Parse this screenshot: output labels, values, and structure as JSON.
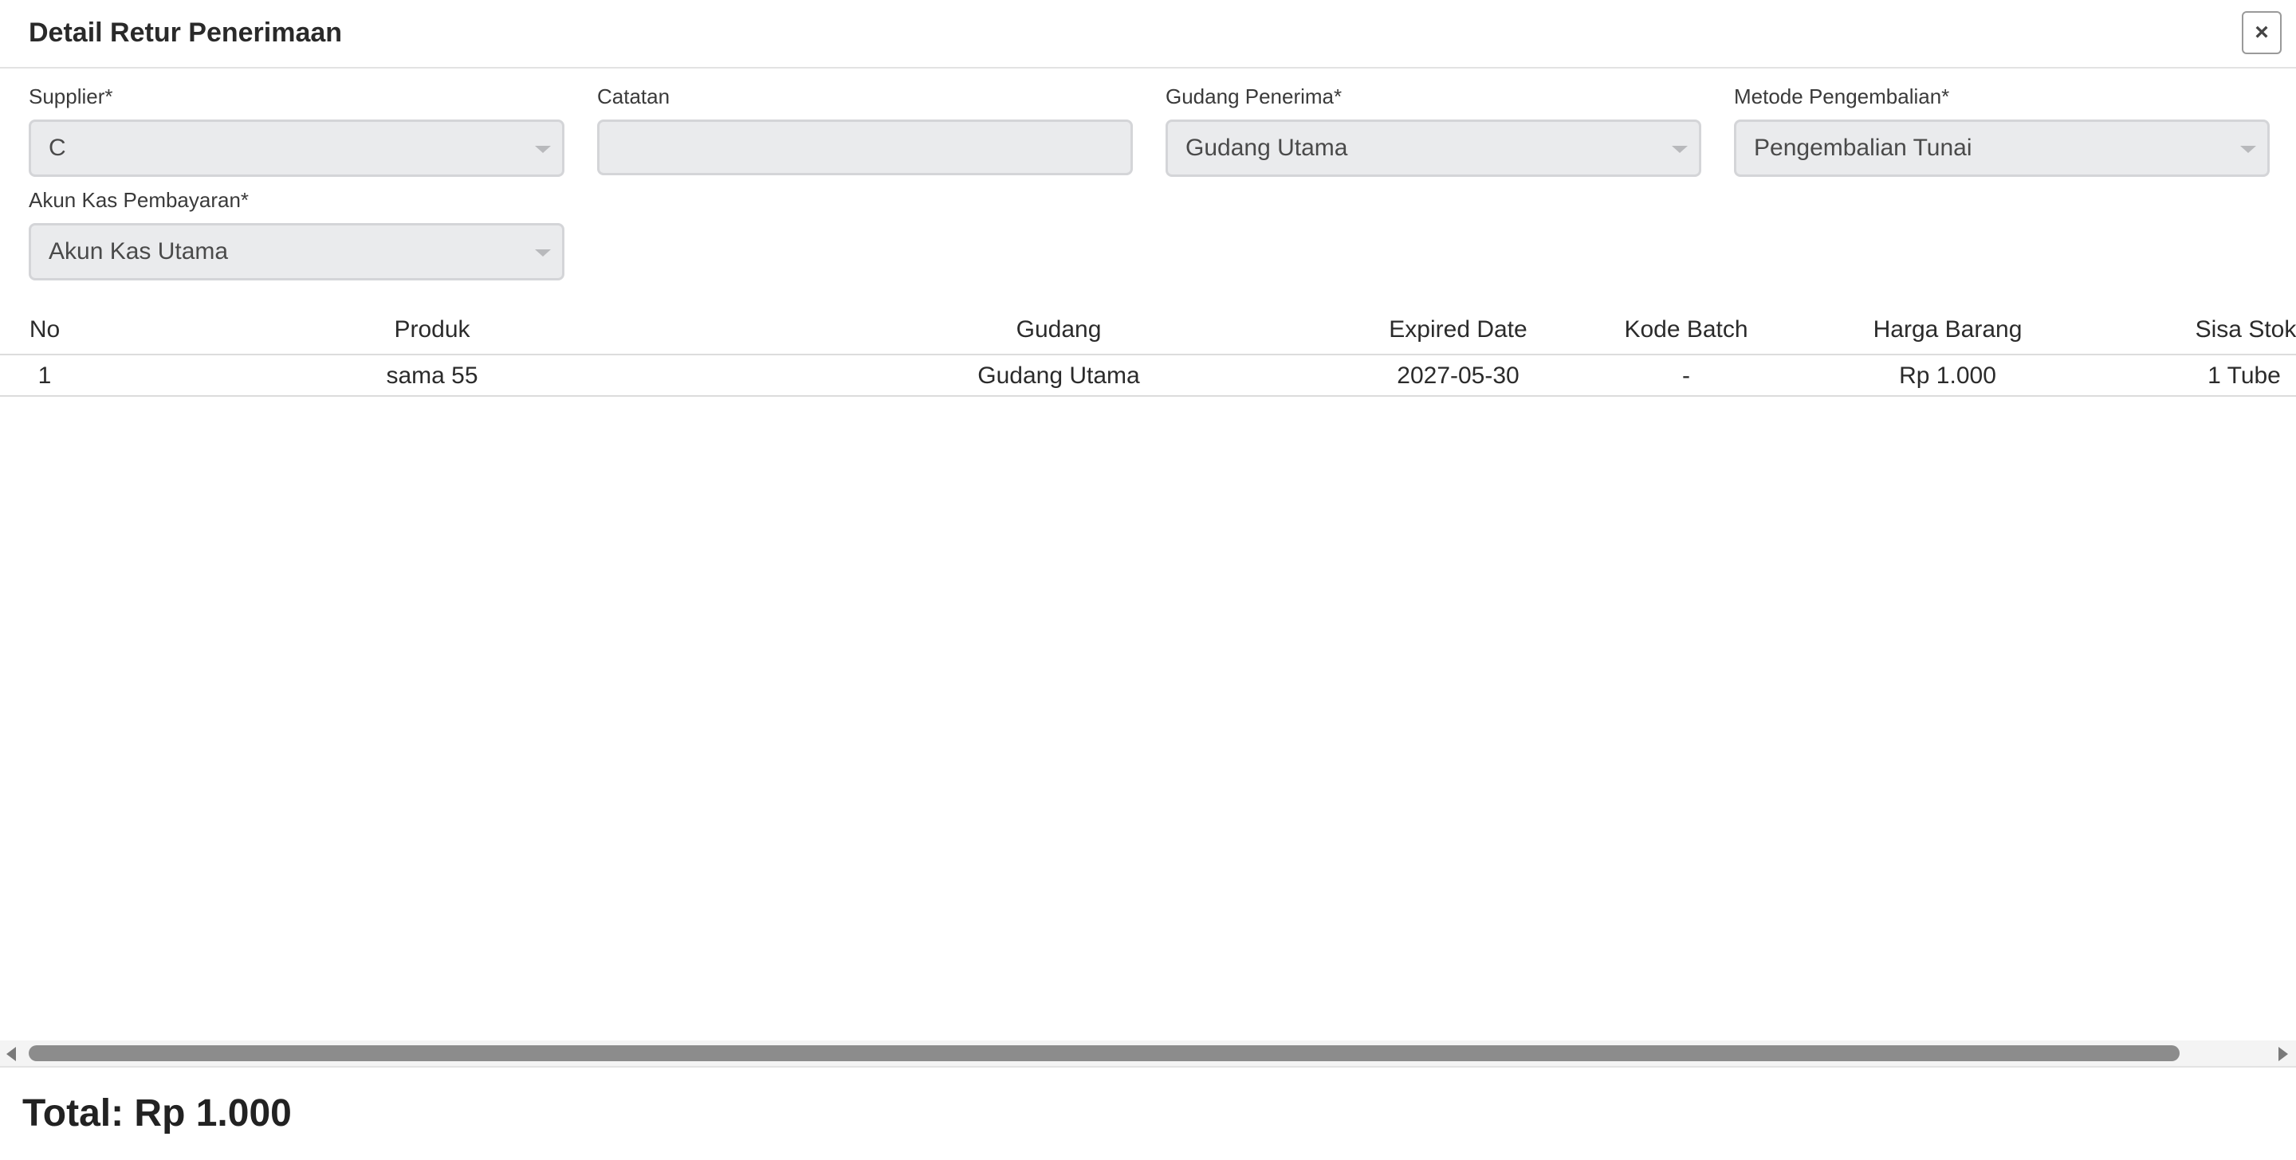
{
  "modal": {
    "title": "Detail Retur Penerimaan",
    "close_label": "×"
  },
  "form": {
    "supplier": {
      "label": "Supplier*",
      "value": "C"
    },
    "catatan": {
      "label": "Catatan",
      "value": ""
    },
    "gudang_penerima": {
      "label": "Gudang Penerima*",
      "value": "Gudang Utama"
    },
    "metode_pengembalian": {
      "label": "Metode Pengembalian*",
      "value": "Pengembalian Tunai"
    },
    "akun_kas": {
      "label": "Akun Kas Pembayaran*",
      "value": "Akun Kas Utama"
    }
  },
  "table": {
    "headers": [
      "No",
      "Produk",
      "Gudang",
      "Expired Date",
      "Kode Batch",
      "Harga Barang",
      "Sisa Stok"
    ],
    "rows": [
      [
        "1",
        "sama 55",
        "Gudang Utama",
        "2027-05-30",
        "-",
        "Rp 1.000",
        "1 Tube"
      ]
    ]
  },
  "footer": {
    "total": "Total: Rp 1.000"
  },
  "colors": {
    "field_bg": "#eaebed",
    "scrollbar_thumb": "#8c8c8c"
  }
}
